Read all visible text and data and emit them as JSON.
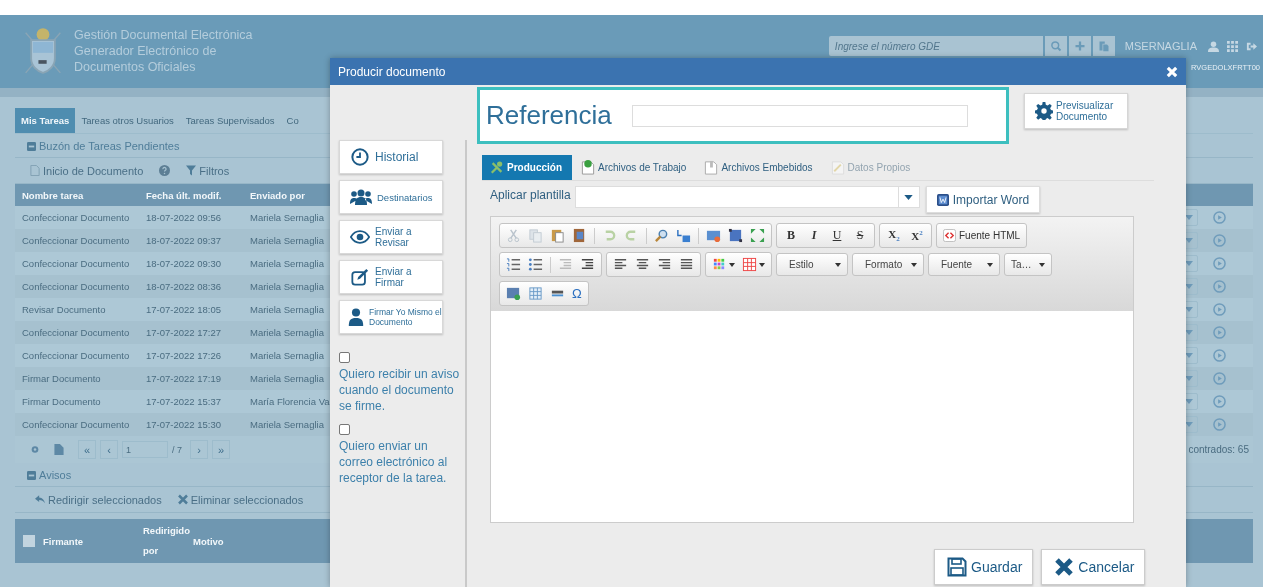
{
  "header": {
    "title_lines": [
      "Gestión Documental Electrónica",
      "Generador Electrónico de",
      "Documentos Oficiales"
    ],
    "search": {
      "placeholder": "Ingrese el número GDE"
    },
    "user": "MSERNAGLIA",
    "station": "RVGEDOLXFRTT00"
  },
  "tabs": [
    {
      "label": "Mis Tareas",
      "selected": true
    },
    {
      "label": "Tareas otros Usuarios",
      "selected": false
    },
    {
      "label": "Tareas Supervisados",
      "selected": false
    },
    {
      "label": "Co",
      "selected": false
    }
  ],
  "tasks": {
    "title": "Buzón de Tareas Pendientes",
    "toolbar": {
      "new": "Inicio de Documento",
      "filters": "Filtros"
    },
    "columns": [
      "Nombre tarea",
      "Fecha últ. modif.",
      "Enviado por"
    ],
    "rows": [
      {
        "name": "Confeccionar Documento",
        "date": "18-07-2022 09:56",
        "sender": "Mariela Sernaglia"
      },
      {
        "name": "Confeccionar Documento",
        "date": "18-07-2022 09:37",
        "sender": "Mariela Sernaglia"
      },
      {
        "name": "Confeccionar Documento",
        "date": "18-07-2022 09:30",
        "sender": "Mariela Sernaglia"
      },
      {
        "name": "Confeccionar Documento",
        "date": "18-07-2022 08:36",
        "sender": "Mariela Sernaglia"
      },
      {
        "name": "Revisar Documento",
        "date": "17-07-2022 18:05",
        "sender": "Mariela Sernaglia"
      },
      {
        "name": "Confeccionar Documento",
        "date": "17-07-2022 17:27",
        "sender": "Mariela Sernaglia"
      },
      {
        "name": "Confeccionar Documento",
        "date": "17-07-2022 17:26",
        "sender": "Mariela Sernaglia"
      },
      {
        "name": "Firmar Documento",
        "date": "17-07-2022 17:19",
        "sender": "Mariela Sernaglia"
      },
      {
        "name": "Firmar Documento",
        "date": "17-07-2022 15:37",
        "sender": "María Florencia Va"
      },
      {
        "name": "Confeccionar Documento",
        "date": "17-07-2022 15:30",
        "sender": "Mariela Sernaglia"
      }
    ],
    "pager": {
      "first": "«",
      "previous": "‹",
      "page": "1",
      "total": "/ 7",
      "next": "›",
      "last": "»"
    },
    "found": "contrados: 65"
  },
  "notices": {
    "title": "Avisos",
    "actions": [
      "Redirigir seleccionados",
      "Eliminar seleccionados"
    ],
    "select_all": {
      "checked": false
    },
    "columns": [
      "Firmante",
      "Redirigido por",
      "Motivo"
    ]
  },
  "modal": {
    "title": "Producir documento",
    "reference_label": "Referencia",
    "preview_button": "Previsualizar Documento",
    "side_buttons": [
      {
        "kind": "history",
        "label": "Historial"
      },
      {
        "kind": "recipients",
        "label": "Destinatarios"
      },
      {
        "kind": "review",
        "label": "Enviar a Revisar"
      },
      {
        "kind": "sign",
        "label": "Enviar a Firmar"
      },
      {
        "kind": "self",
        "label": "Firmar Yo Mismo el Documento"
      }
    ],
    "options": [
      {
        "label": "Quiero recibir un aviso cuando el documento se firme.",
        "checked": false
      },
      {
        "label": "Quiero enviar un correo electrónico al receptor de la tarea.",
        "checked": false
      }
    ],
    "tabs": [
      {
        "label": "Producción",
        "selected": true,
        "disabled": false
      },
      {
        "label": "Archivos de Trabajo",
        "selected": false,
        "disabled": false
      },
      {
        "label": "Archivos Embebidos",
        "selected": false,
        "disabled": false
      },
      {
        "label": "Datos Propios",
        "selected": false,
        "disabled": true
      }
    ],
    "template_label": "Aplicar plantilla",
    "import_button": "Importar Word",
    "editor": {
      "format_buttons": [
        "B",
        "I",
        "U",
        "S"
      ],
      "script_buttons": [
        "X$_{2}$",
        "X$^{2}$"
      ],
      "source_button": "Fuente HTML",
      "combos": [
        "Estilo",
        "Formato",
        "Fuente",
        "Ta…"
      ],
      "special_char": "Ω"
    },
    "save": "Guardar",
    "cancel": "Cancelar"
  }
}
